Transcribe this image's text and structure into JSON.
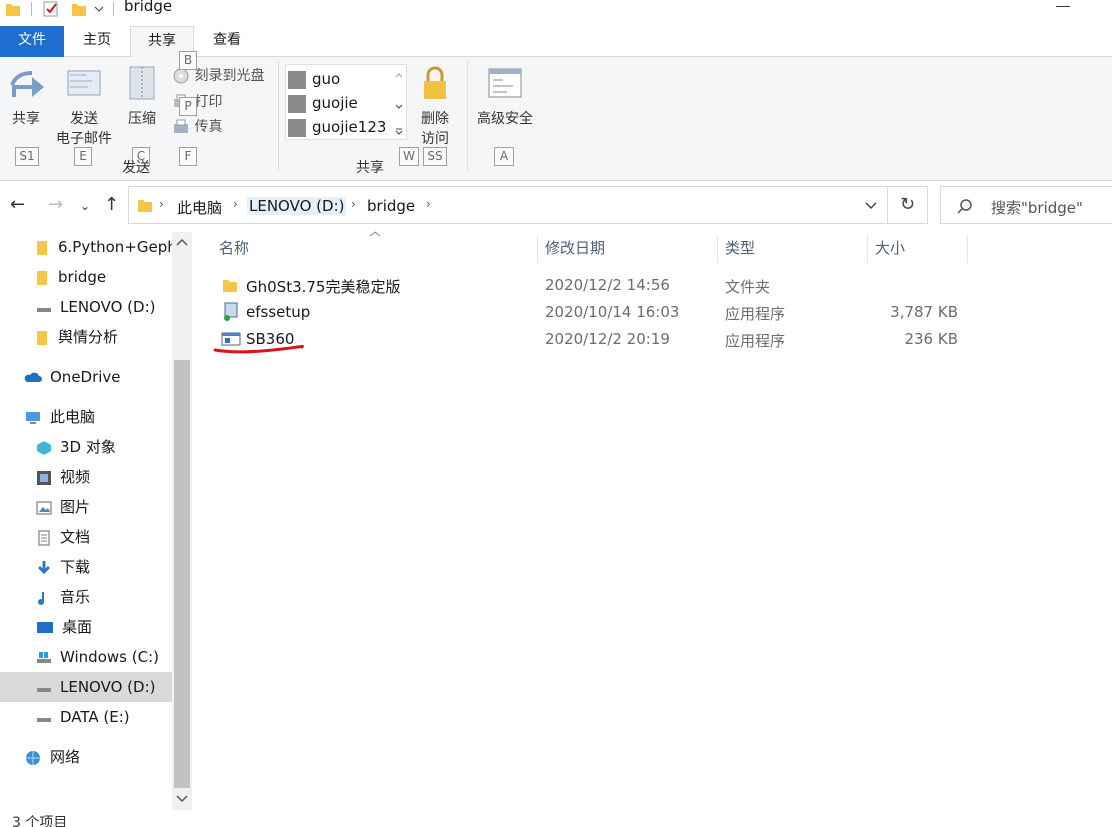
{
  "window": {
    "title": "bridge"
  },
  "ribbon": {
    "tabs": [
      "文件",
      "主页",
      "共享",
      "查看"
    ],
    "share_button": "共享",
    "email_button_line1": "发送",
    "email_button_line2": "电子邮件",
    "zip_button": "压缩",
    "burn_disc": "刻录到光盘",
    "print": "打印",
    "fax": "传真",
    "send_group": "发送",
    "users": [
      "guo",
      "guojie",
      "guojie123"
    ],
    "share_group": "共享",
    "remove_access_line1": "删除",
    "remove_access_line2": "访问",
    "advanced_security": "高级安全",
    "keytips": {
      "share": "S1",
      "email": "E",
      "zip": "C",
      "fax": "F",
      "burn": "B",
      "print": "P",
      "w": "W",
      "ss": "SS",
      "a": "A"
    }
  },
  "address": {
    "crumbs": [
      "此电脑",
      "LENOVO (D:)",
      "bridge"
    ],
    "search_placeholder": "搜索\"bridge\""
  },
  "sidebar": {
    "items": [
      {
        "label": "6.Python+Geph",
        "icon": "folder-icon"
      },
      {
        "label": "bridge",
        "icon": "folder-icon"
      },
      {
        "label": "LENOVO (D:)",
        "icon": "drive-icon"
      },
      {
        "label": "舆情分析",
        "icon": "folder-icon"
      },
      {
        "label": "OneDrive",
        "icon": "cloud-icon"
      },
      {
        "label": "此电脑",
        "icon": "computer-icon"
      },
      {
        "label": "3D 对象",
        "icon": "cube-icon"
      },
      {
        "label": "视频",
        "icon": "film-icon"
      },
      {
        "label": "图片",
        "icon": "picture-icon"
      },
      {
        "label": "文档",
        "icon": "document-icon"
      },
      {
        "label": "下载",
        "icon": "download-icon"
      },
      {
        "label": "音乐",
        "icon": "music-icon"
      },
      {
        "label": "桌面",
        "icon": "desktop-icon"
      },
      {
        "label": "Windows (C:)",
        "icon": "windows-drive-icon"
      },
      {
        "label": "LENOVO (D:)",
        "icon": "drive-icon"
      },
      {
        "label": "DATA (E:)",
        "icon": "drive-icon"
      },
      {
        "label": "网络",
        "icon": "network-icon"
      }
    ]
  },
  "filelist": {
    "columns": [
      "名称",
      "修改日期",
      "类型",
      "大小"
    ],
    "rows": [
      {
        "name": "Gh0St3.75完美稳定版",
        "date": "2020/12/2 14:56",
        "type": "文件夹",
        "size": ""
      },
      {
        "name": "efssetup",
        "date": "2020/10/14 16:03",
        "type": "应用程序",
        "size": "3,787 KB"
      },
      {
        "name": "SB360",
        "date": "2020/12/2 20:19",
        "type": "应用程序",
        "size": "236 KB"
      }
    ]
  },
  "status": {
    "text": "3 个项目"
  },
  "colors": {
    "file_tab": "#1e6fd0",
    "annotation": "#d8141b",
    "folder": "#f4c548"
  }
}
